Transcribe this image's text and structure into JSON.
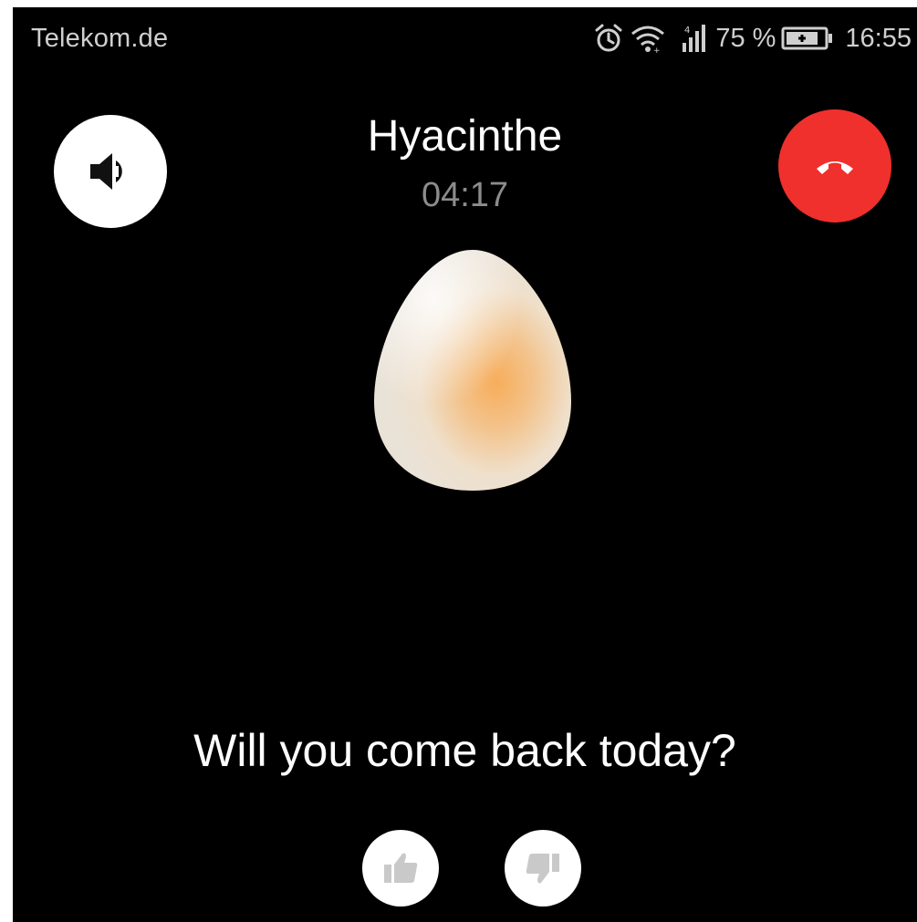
{
  "status_bar": {
    "carrier": "Telekom.de",
    "battery_percent": "75 %",
    "time": "16:55",
    "icons": [
      "alarm-icon",
      "wifi-icon",
      "signal-icon",
      "battery-charging-icon"
    ]
  },
  "call": {
    "caller_name": "Hyacinthe",
    "duration": "04:17",
    "speaker_icon": "speaker-icon",
    "hangup_icon": "hangup-icon",
    "hangup_color": "#f0302c"
  },
  "prompt": {
    "question": "Will you come back today?",
    "answers": [
      "thumbs-up-icon",
      "thumbs-down-icon"
    ]
  }
}
